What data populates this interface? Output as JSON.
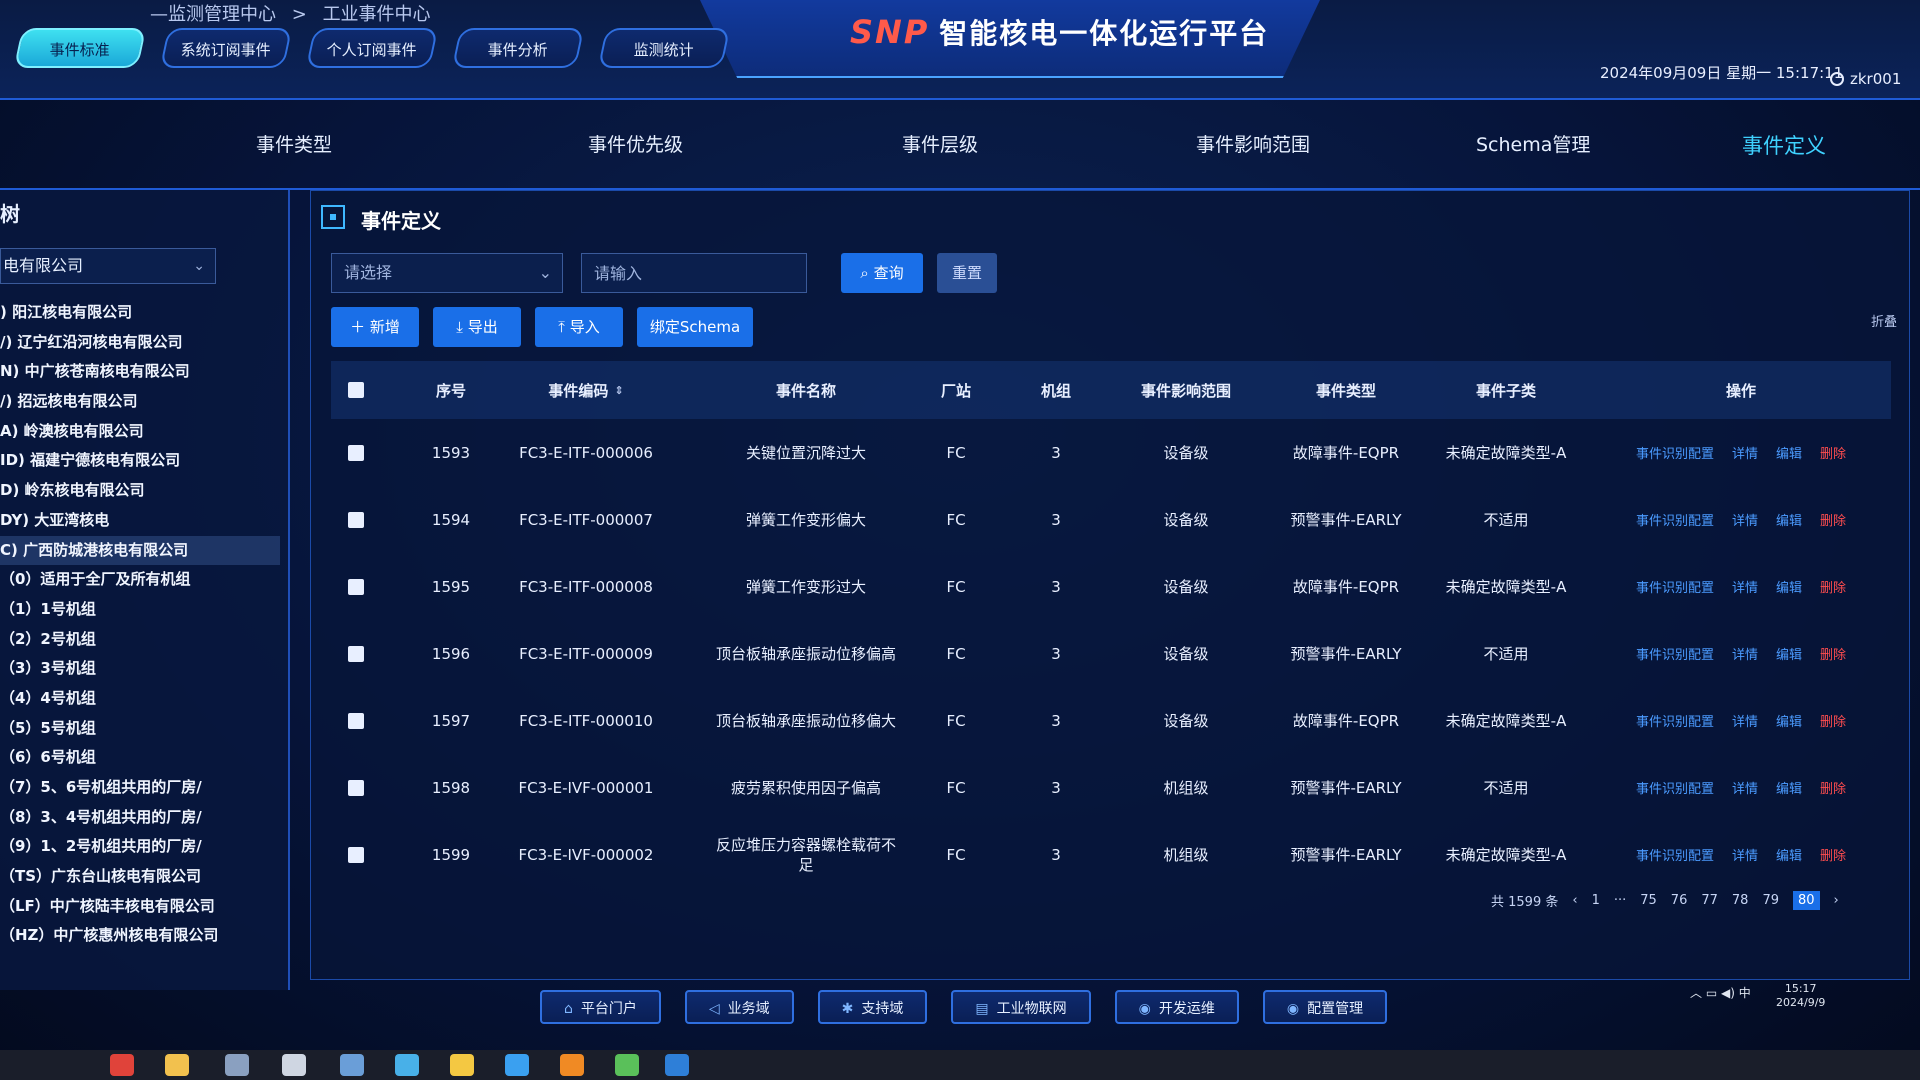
{
  "header": {
    "breadcrumb": [
      "—监测管理中心",
      ">",
      "工业事件中心"
    ],
    "brand": "SNP",
    "title": "智能核电一体化运行平台",
    "datetime": "2024年09月09日 星期一 15:17:11",
    "user": "zkr001",
    "tabs": [
      "事件标准",
      "系统订阅事件",
      "个人订阅事件",
      "事件分析",
      "监测统计"
    ]
  },
  "category_tabs": [
    "事件类型",
    "事件优先级",
    "事件层级",
    "事件影响范围",
    "Schema管理",
    "事件定义"
  ],
  "sidebar": {
    "title": "树",
    "company_select": "电有限公司",
    "tree": [
      ") 阳江核电有限公司",
      "/) 辽宁红沿河核电有限公司",
      "N) 中广核苍南核电有限公司",
      "/) 招远核电有限公司",
      "A) 岭澳核电有限公司",
      "ID) 福建宁德核电有限公司",
      "D) 岭东核电有限公司",
      "DY) 大亚湾核电",
      "C) 广西防城港核电有限公司",
      "（0）适用于全厂及所有机组",
      "（1）1号机组",
      "（2）2号机组",
      "（3）3号机组",
      "（4）4号机组",
      "（5）5号机组",
      "（6）6号机组",
      "（7）5、6号机组共用的厂房/",
      "（8）3、4号机组共用的厂房/",
      "（9）1、2号机组共用的厂房/",
      "（TS）广东台山核电有限公司",
      "（LF）中广核陆丰核电有限公司",
      "（HZ）中广核惠州核电有限公司"
    ]
  },
  "main": {
    "title": "事件定义",
    "filter_placeholder": "请选择",
    "input_placeholder": "请输入",
    "query_label": "查询",
    "reset_label": "重置",
    "add_label": "新增",
    "export_label": "导出",
    "import_label": "导入",
    "bind_label": "绑定Schema",
    "collapse_label": "折叠",
    "columns": [
      "序号",
      "事件编码",
      "事件名称",
      "厂站",
      "机组",
      "事件影响范围",
      "事件类型",
      "事件子类",
      "操作"
    ],
    "rows": [
      {
        "seq": "1593",
        "code": "FC3-E-ITF-000006",
        "name": "关键位置沉降过大",
        "site": "FC",
        "unit": "3",
        "scope": "设备级",
        "type": "故障事件-EQPR",
        "subtype": "未确定故障类型-A"
      },
      {
        "seq": "1594",
        "code": "FC3-E-ITF-000007",
        "name": "弹簧工作变形偏大",
        "site": "FC",
        "unit": "3",
        "scope": "设备级",
        "type": "预警事件-EARLY",
        "subtype": "不适用"
      },
      {
        "seq": "1595",
        "code": "FC3-E-ITF-000008",
        "name": "弹簧工作变形过大",
        "site": "FC",
        "unit": "3",
        "scope": "设备级",
        "type": "故障事件-EQPR",
        "subtype": "未确定故障类型-A"
      },
      {
        "seq": "1596",
        "code": "FC3-E-ITF-000009",
        "name": "顶台板轴承座振动位移偏高",
        "site": "FC",
        "unit": "3",
        "scope": "设备级",
        "type": "预警事件-EARLY",
        "subtype": "不适用"
      },
      {
        "seq": "1597",
        "code": "FC3-E-ITF-000010",
        "name": "顶台板轴承座振动位移偏大",
        "site": "FC",
        "unit": "3",
        "scope": "设备级",
        "type": "故障事件-EQPR",
        "subtype": "未确定故障类型-A"
      },
      {
        "seq": "1598",
        "code": "FC3-E-IVF-000001",
        "name": "疲劳累积使用因子偏高",
        "site": "FC",
        "unit": "3",
        "scope": "机组级",
        "type": "预警事件-EARLY",
        "subtype": "不适用"
      },
      {
        "seq": "1599",
        "code": "FC3-E-IVF-000002",
        "name": "反应堆压力容器螺栓载荷不足",
        "site": "FC",
        "unit": "3",
        "scope": "机组级",
        "type": "预警事件-EARLY",
        "subtype": "未确定故障类型-A"
      }
    ],
    "actions": {
      "config": "事件识别配置",
      "detail": "详情",
      "edit": "编辑",
      "delete": "删除"
    },
    "pager": {
      "total": "共 1599 条",
      "prev": "‹",
      "next": "›",
      "pages": [
        "1",
        "···",
        "75",
        "76",
        "77",
        "78",
        "79",
        "80"
      ],
      "current": "80"
    }
  },
  "bottom_nav": [
    {
      "icon": "⌂",
      "label": "平台门户"
    },
    {
      "icon": "◁",
      "label": "业务域"
    },
    {
      "icon": "✱",
      "label": "支持域"
    },
    {
      "icon": "▤",
      "label": "工业物联网"
    },
    {
      "icon": "◉",
      "label": "开发运维"
    },
    {
      "icon": "◉",
      "label": "配置管理"
    }
  ],
  "tray": {
    "time": "15:17",
    "date": "2024/9/9",
    "ime": "中"
  },
  "colors": {
    "accent": "#1a6fe8",
    "active_tab": "#3fd2ff",
    "danger": "#ff4d4f",
    "link": "#4b9bff"
  }
}
